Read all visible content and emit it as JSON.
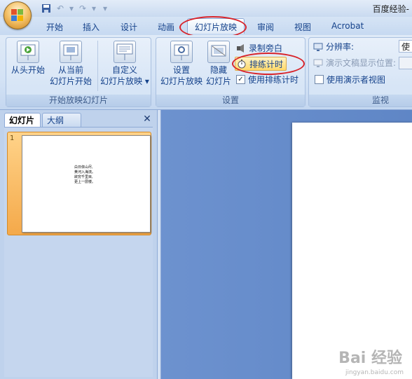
{
  "window": {
    "title": "百度经验-"
  },
  "quick_access": {
    "save": "save-icon",
    "undo": "↶",
    "redo": "↷",
    "customize": "▾"
  },
  "tabs": [
    "开始",
    "插入",
    "设计",
    "动画",
    "幻灯片放映",
    "审阅",
    "视图",
    "Acrobat"
  ],
  "active_tab": "幻灯片放映",
  "ribbon": {
    "group_start": {
      "label": "开始放映幻灯片",
      "from_beginning": "从头开始",
      "from_current_1": "从当前",
      "from_current_2": "幻灯片开始",
      "custom_1": "自定义",
      "custom_2": "幻灯片放映 ▾"
    },
    "group_setup": {
      "label": "设置",
      "setup_show_1": "设置",
      "setup_show_2": "幻灯片放映",
      "hide_slide_1": "隐藏",
      "hide_slide_2": "幻灯片",
      "record_narration": "录制旁白",
      "rehearse_timings": "排练计时",
      "use_rehearsed_timings": "使用排练计时",
      "use_rehearsed_checked": "✓"
    },
    "group_monitors": {
      "label": "监视",
      "resolution": "分辨率:",
      "resolution_value": "使",
      "show_on": "演示文稿显示位置:",
      "presenter_view": "使用演示者视图"
    }
  },
  "left_pane": {
    "tab_slides": "幻灯片",
    "tab_outline": "大纲",
    "close": "✕",
    "slide_number": "1",
    "slide_lines": [
      "白日依山尽,",
      "黄河入海流。",
      "欲穷千里目,",
      "更上一层楼。"
    ]
  },
  "watermark": {
    "main": "Bai 经验",
    "sub": "jingyan.baidu.com"
  },
  "colors": {
    "annotation": "#d8232a",
    "selection": "#f4a94a"
  }
}
